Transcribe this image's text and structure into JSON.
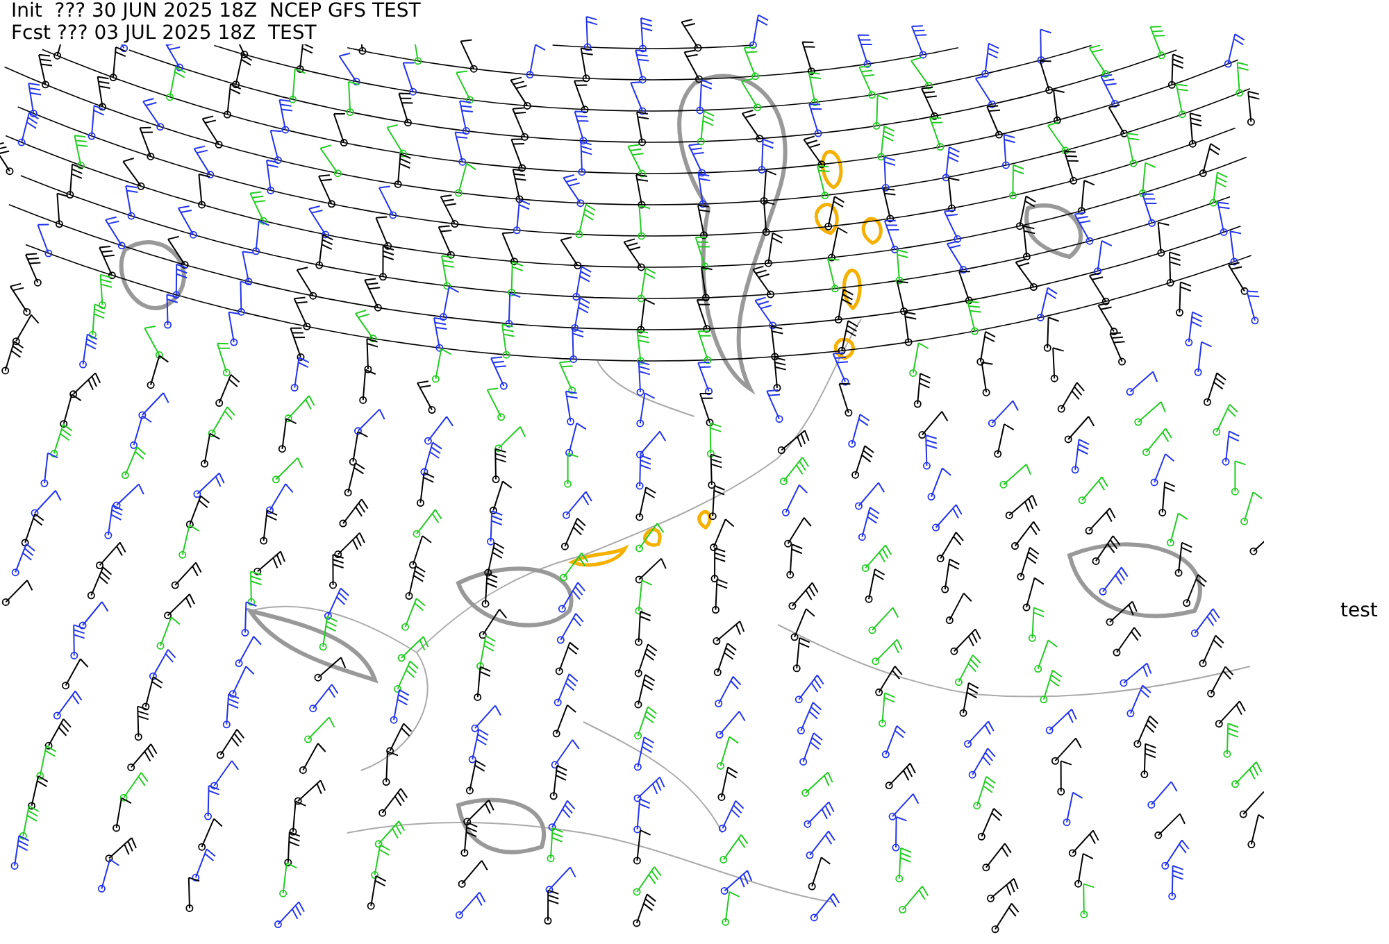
{
  "header": {
    "init_line": "Init  ??? 30 JUN 2025 18Z  NCEP GFS TEST",
    "forecast_line": "Fcst ??? 03 JUL 2025 18Z  TEST"
  },
  "side_label": "test"
}
